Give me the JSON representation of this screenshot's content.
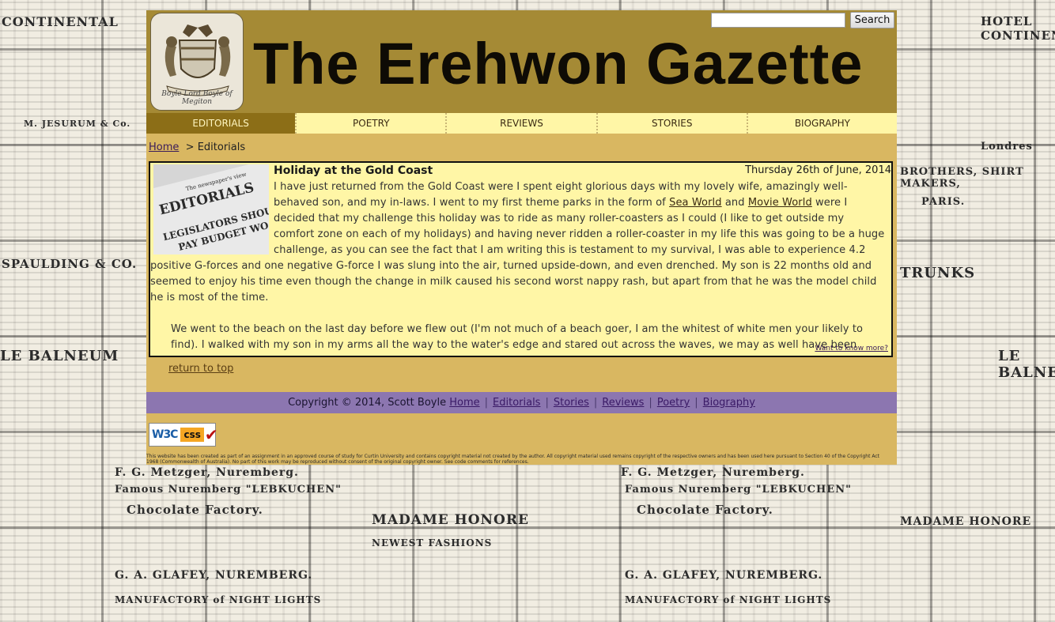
{
  "header": {
    "title": "The Erehwon Gazette",
    "logo_motto": "Boyle Lord Boyle of Megiton",
    "search": {
      "value": "",
      "button_label": "Search"
    }
  },
  "nav": {
    "tabs": [
      {
        "label": "EDITORIALS",
        "active": true
      },
      {
        "label": "POETRY",
        "active": false
      },
      {
        "label": "REVIEWS",
        "active": false
      },
      {
        "label": "STORIES",
        "active": false
      },
      {
        "label": "BIOGRAPHY",
        "active": false
      }
    ]
  },
  "breadcrumb": {
    "home": "Home",
    "separator": ">",
    "current": "Editorials"
  },
  "article": {
    "image_text": {
      "headline": "EDITORIALS",
      "subhead": "The newspaper's view",
      "line1": "LEGISLATORS SHOULD",
      "line2": "PAY BUDGET WO"
    },
    "title": "Holiday at the Gold Coast",
    "date": "Thursday 26th of June, 2014",
    "p1_a": "I have just returned from the Gold Coast were I spent eight glorious days with my lovely wife, amazingly well-behaved son, and my in-laws. I went to my first theme parks in the form of ",
    "p1_link1": "Sea World",
    "p1_b": " and ",
    "p1_link2": "Movie World",
    "p1_c": " were I decided that my challenge this holiday was to ride as many roller-coasters as I could (I like to get outside my comfort zone on each of my holidays) and having never ridden a roller-coaster in my life this was going to be a huge challenge, as you can see the fact that I am writing this is testament to my survival, I was able to experience 4.2 positive G-forces and one negative G-force I was slung into the air, turned upside-down, and even drenched. My son is 22 months old and seemed to enjoy his time even though the change in milk caused his second worst nappy rash, but apart from that he was the model child he is most of the time.",
    "p2": "We went to the beach on the last day before we flew out (I'm not much of a beach goer, I am the whitest of white men your likely to find). I walked with my son in my arms all the way to the water's edge and stared out across the waves, we may as well have been the only ones there, I could have stood there all day lost in the moment mesmerised by the ocean's rhythmic crashing of waves.",
    "more_link": "Want to know more?"
  },
  "return_top": "return to top",
  "footer": {
    "copyright": "Copyright © 2014, Scott Boyle",
    "links": [
      "Home",
      "Editorials",
      "Stories",
      "Reviews",
      "Poetry",
      "Biography"
    ],
    "separator": "|"
  },
  "badge": {
    "w3c": "W3C",
    "css": "css",
    "check": "✔"
  },
  "disclaimer": "This website has been created as part of an assignment in an approved course of study for Curtin University and contains copyright material not created by the author. All copyright material used remains copyright of the respective owners and has been used here pursuant to Section 40 of the Copyright Act 1968 (Commonwealth of Australia). No part of this work may be reproduced without consent of the original copyright owner. See code comments for references.",
  "background_ads": [
    "CONTINENTAL",
    "HOTEL CONTINENTAL",
    "MADAME HONORE",
    "NEWEST FASHIONS",
    "LE BALNEUM",
    "G. A. GLAFEY, NUREMBERG.",
    "MANUFACTORY of NIGHT LIGHTS",
    "Famous Nuremberg \"LEBKUCHEN\"",
    "Chocolate Factory.",
    "F. G. Metzger, Nuremberg.",
    "TRUNKS",
    "BROTHERS, SHIRT MAKERS,",
    "PARIS.",
    "M. JESURUM & Co.",
    "SPAULDING & CO.",
    "Londres"
  ],
  "colors": {
    "header_bg": "#a58a35",
    "nav_bg": "#fff6a6",
    "nav_active_bg": "#8c6e17",
    "content_bg": "#d9b761",
    "footer_bg": "#8c76b0"
  }
}
